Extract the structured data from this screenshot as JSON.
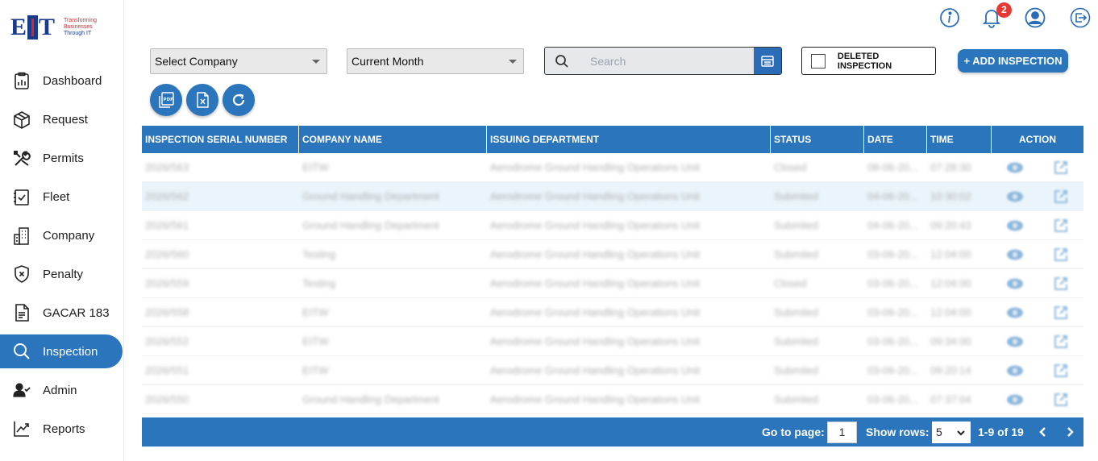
{
  "logo": {
    "letters": "EIT",
    "tagline": [
      "Transforming",
      "Businesses",
      "Through IT"
    ]
  },
  "sidebar": {
    "items": [
      {
        "label": "Dashboard",
        "icon": "dashboard-icon"
      },
      {
        "label": "Request",
        "icon": "box-icon"
      },
      {
        "label": "Permits",
        "icon": "tools-icon"
      },
      {
        "label": "Fleet",
        "icon": "checklist-icon"
      },
      {
        "label": "Company",
        "icon": "building-icon"
      },
      {
        "label": "Penalty",
        "icon": "shield-x-icon"
      },
      {
        "label": "GACAR 183",
        "icon": "document-icon"
      },
      {
        "label": "Inspection",
        "icon": "search-icon",
        "active": true
      },
      {
        "label": "Admin",
        "icon": "user-check-icon"
      },
      {
        "label": "Reports",
        "icon": "trend-chart-icon"
      }
    ]
  },
  "header": {
    "notification_count": "2"
  },
  "filters": {
    "company": "Select Company",
    "period": "Current Month",
    "search_placeholder": "Search",
    "deleted_label": "DELETED INSPECTION",
    "add_label": "+ ADD INSPECTION"
  },
  "table": {
    "columns": [
      "INSPECTION SERIAL NUMBER",
      "COMPANY NAME",
      "ISSUING DEPARTMENT",
      "STATUS",
      "DATE",
      "TIME",
      "ACTION"
    ],
    "rows": [
      [
        "2026/563",
        "EITW",
        "Aerodrome Ground Handling Operations Unit",
        "Closed",
        "08-06-20...",
        "07:28:30"
      ],
      [
        "2026/562",
        "Ground Handling Department",
        "Aerodrome Ground Handling Operations Unit",
        "Submited",
        "04-06-20...",
        "10:30:02"
      ],
      [
        "2026/561",
        "Ground Handling Department",
        "Aerodrome Ground Handling Operations Unit",
        "Submited",
        "04-06-20...",
        "09:20:43"
      ],
      [
        "2026/560",
        "Testing",
        "Aerodrome Ground Handling Operations Unit",
        "Submited",
        "03-06-20...",
        "12:04:00"
      ],
      [
        "2026/559",
        "Testing",
        "Aerodrome Ground Handling Operations Unit",
        "Closed",
        "03-06-20...",
        "12:04:00"
      ],
      [
        "2026/558",
        "EITW",
        "Aerodrome Ground Handling Operations Unit",
        "Submited",
        "03-06-20...",
        "12:04:00"
      ],
      [
        "2026/552",
        "EITW",
        "Aerodrome Ground Handling Operations Unit",
        "Submited",
        "03-06-20...",
        "09:34:00"
      ],
      [
        "2026/551",
        "EITW",
        "Aerodrome Ground Handling Operations Unit",
        "Submited",
        "03-06-20...",
        "09:20:14"
      ],
      [
        "2026/550",
        "Ground Handling Department",
        "Aerodrome Ground Handling Operations Unit",
        "Submited",
        "03-06-20...",
        "07:37:04"
      ]
    ]
  },
  "pagination": {
    "go_to_label": "Go to page:",
    "page": "1",
    "rows_label": "Show rows:",
    "rows_value": "5",
    "range": "1-9 of 19"
  },
  "colors": {
    "primary": "#2a75bb",
    "badge": "#e53935",
    "row_alt": "#eaf5fb"
  }
}
